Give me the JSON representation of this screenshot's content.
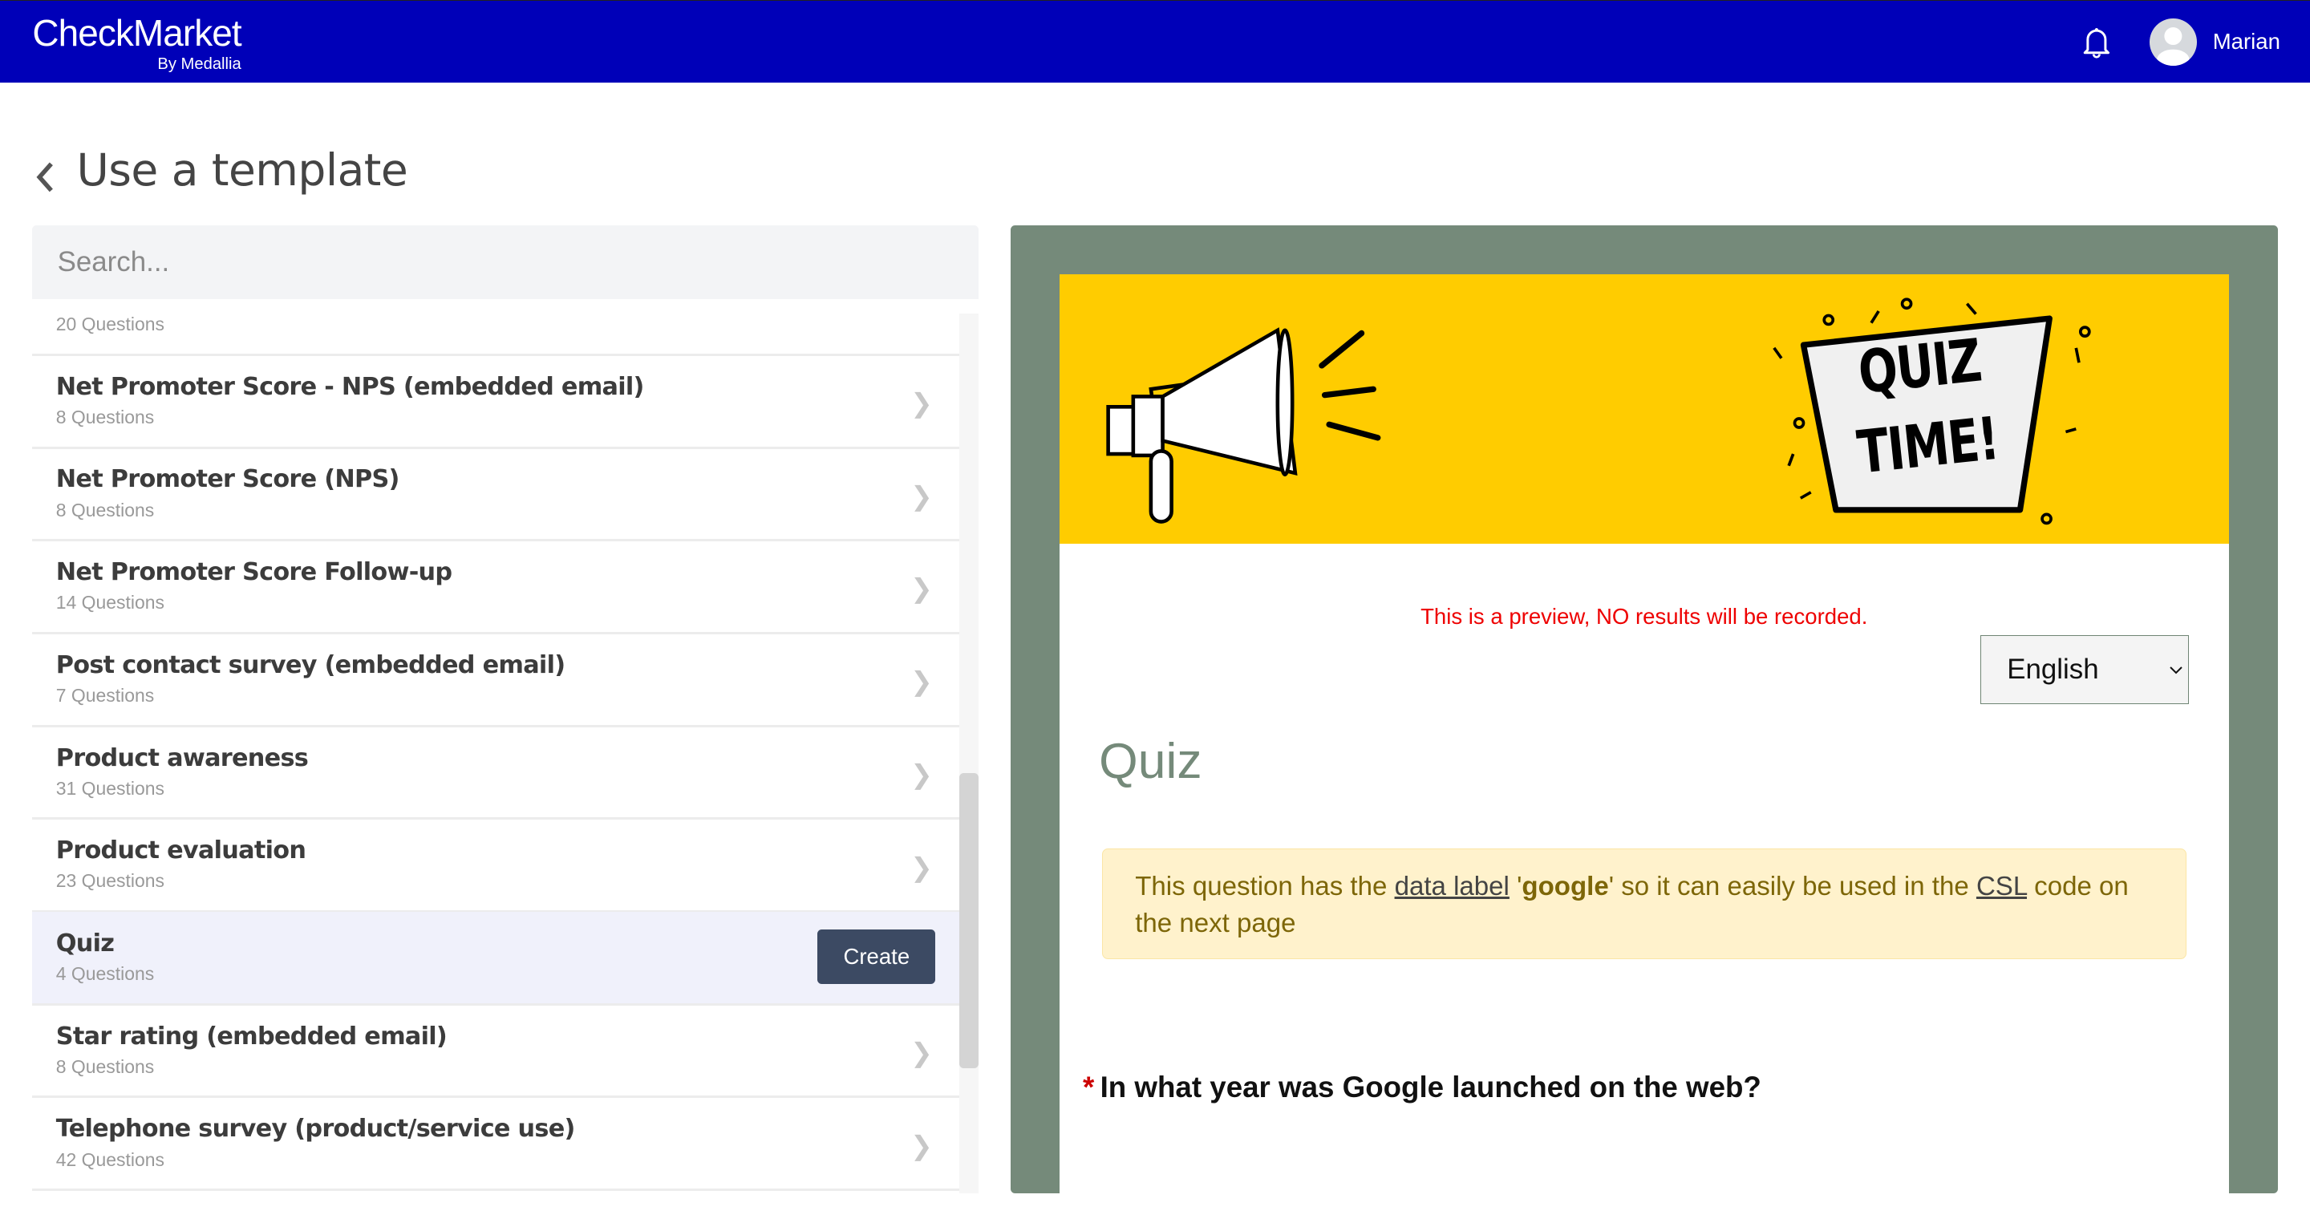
{
  "header": {
    "brand": "CheckMarket",
    "brand_sub": "By Medallia",
    "user_name": "Marian",
    "bg_color": "#0000b8"
  },
  "page": {
    "title": "Use a template"
  },
  "search": {
    "placeholder": "Search..."
  },
  "templates": {
    "partial_top": {
      "questions": "20 Questions"
    },
    "items": [
      {
        "title": "Net Promoter Score - NPS (embedded email)",
        "questions": "8 Questions"
      },
      {
        "title": "Net Promoter Score (NPS)",
        "questions": "8 Questions"
      },
      {
        "title": "Net Promoter Score Follow-up",
        "questions": "14 Questions"
      },
      {
        "title": "Post contact survey (embedded email)",
        "questions": "7 Questions"
      },
      {
        "title": "Product awareness",
        "questions": "31 Questions"
      },
      {
        "title": "Product evaluation",
        "questions": "23 Questions"
      },
      {
        "title": "Quiz",
        "questions": "4 Questions",
        "selected": true
      },
      {
        "title": "Star rating (embedded email)",
        "questions": "8 Questions"
      },
      {
        "title": "Telephone survey (product/service use)",
        "questions": "42 Questions"
      }
    ],
    "create_label": "Create"
  },
  "preview": {
    "banner_text": "QUIZ TIME!",
    "notice": "This is a preview, NO results will be recorded.",
    "language": "English",
    "survey_title": "Quiz",
    "alert": {
      "p1": "This question has the ",
      "link1": "data label",
      "p2": " '",
      "bold": "google",
      "p3": "' so it can easily be used in the ",
      "link2": "CSL",
      "p4": " code on the next page"
    },
    "question_required": "*",
    "question": "In what year was Google launched on the web?",
    "frame_color": "#758a7a",
    "banner_color": "#ffcc00"
  }
}
